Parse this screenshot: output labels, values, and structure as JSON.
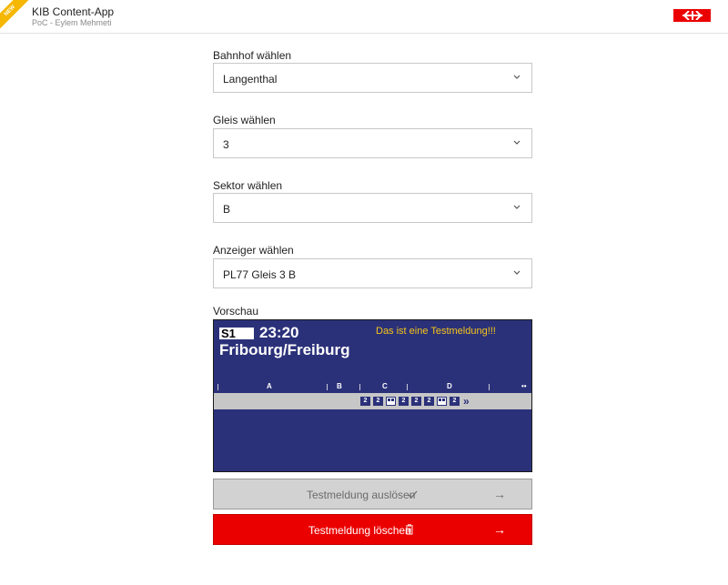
{
  "header": {
    "badge": "NEW",
    "title": "KIB Content-App",
    "subtitle": "PoC - Eylem Mehmeti",
    "logo_icon": "sbb-logo-icon",
    "brand_color": "#eb0000"
  },
  "form": {
    "station": {
      "label": "Bahnhof wählen",
      "value": "Langenthal"
    },
    "track": {
      "label": "Gleis wählen",
      "value": "3"
    },
    "sector": {
      "label": "Sektor wählen",
      "value": "B"
    },
    "display": {
      "label": "Anzeiger wählen",
      "value": "PL77 Gleis 3 B"
    }
  },
  "preview": {
    "label": "Vorschau",
    "line": "S1",
    "time": "23:20",
    "message": "Das ist eine Testmeldung!!!",
    "destination": "Fribourg/Freiburg",
    "sectors": [
      "A",
      "B",
      "C",
      "D"
    ],
    "cars": [
      {
        "type": "class",
        "text": "2"
      },
      {
        "type": "class",
        "text": "2"
      },
      {
        "type": "dining",
        "text": ""
      },
      {
        "type": "class",
        "text": "2"
      },
      {
        "type": "class",
        "text": "2"
      },
      {
        "type": "class",
        "text": "2"
      },
      {
        "type": "dining",
        "text": ""
      },
      {
        "type": "class",
        "text": "2"
      }
    ],
    "direction": "»",
    "colors": {
      "background": "#2b3179",
      "message": "#f5c518"
    }
  },
  "actions": {
    "trigger": {
      "label": "Testmeldung auslösen",
      "icon": "check-icon",
      "arrow": "→"
    },
    "delete": {
      "label": "Testmeldung löschen",
      "icon": "trash-icon",
      "arrow": "→"
    }
  }
}
